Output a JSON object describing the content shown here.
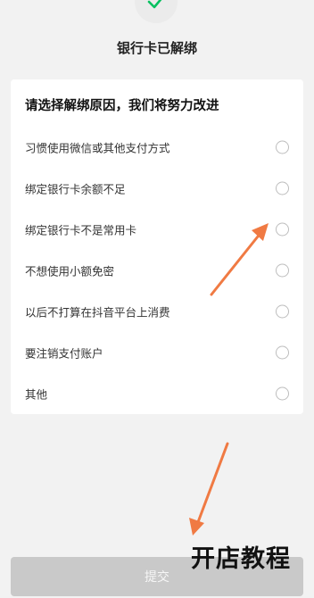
{
  "header": {
    "title": "银行卡已解绑",
    "status_icon": "check-icon"
  },
  "reasons": {
    "heading": "请选择解绑原因，我们将努力改进",
    "options": [
      {
        "label": "习惯使用微信或其他支付方式",
        "selected": false
      },
      {
        "label": "绑定银行卡余额不足",
        "selected": false
      },
      {
        "label": "绑定银行卡不是常用卡",
        "selected": false
      },
      {
        "label": "不想使用小额免密",
        "selected": false
      },
      {
        "label": "以后不打算在抖音平台上消费",
        "selected": false
      },
      {
        "label": "要注销支付账户",
        "selected": false
      },
      {
        "label": "其他",
        "selected": false
      }
    ]
  },
  "footer": {
    "submit_label": "提交"
  },
  "watermark": {
    "text": "开店教程"
  },
  "colors": {
    "check": "#07c160",
    "arrow": "#f07a43",
    "submit_disabled": "#c9c9c9"
  }
}
